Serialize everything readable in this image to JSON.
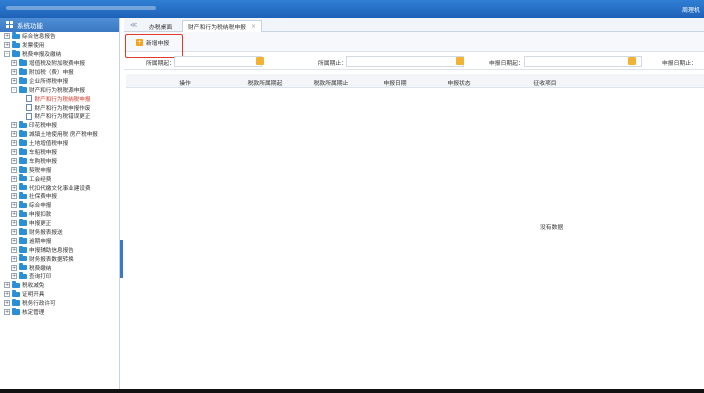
{
  "header": {
    "user_text": "周理机"
  },
  "sidebar": {
    "title": "系统功能",
    "items": [
      {
        "label": "综合信息报告",
        "level": 0,
        "toggle": "+",
        "icon": "folder"
      },
      {
        "label": "发票使用",
        "level": 0,
        "toggle": "+",
        "icon": "folder"
      },
      {
        "label": "税费申报及缴纳",
        "level": 0,
        "toggle": "-",
        "icon": "folder"
      },
      {
        "label": "增值税及附加税费申报",
        "level": 1,
        "toggle": "+",
        "icon": "folder"
      },
      {
        "label": "附加税（费）申报",
        "level": 1,
        "toggle": "+",
        "icon": "folder"
      },
      {
        "label": "企业所得税申报",
        "level": 1,
        "toggle": "+",
        "icon": "folder"
      },
      {
        "label": "财产和行为税税源申报",
        "level": 1,
        "toggle": "-",
        "icon": "folder"
      },
      {
        "label": "财产和行为税纳税申报",
        "level": 2,
        "toggle": "",
        "icon": "doc",
        "active": true
      },
      {
        "label": "财产和行为税申报作废",
        "level": 2,
        "toggle": "",
        "icon": "doc"
      },
      {
        "label": "财产和行为税错误更正",
        "level": 2,
        "toggle": "",
        "icon": "doc"
      },
      {
        "label": "印花税申报",
        "level": 1,
        "toggle": "+",
        "icon": "folder"
      },
      {
        "label": "城镇土地使用税 房产税申报",
        "level": 1,
        "toggle": "+",
        "icon": "folder"
      },
      {
        "label": "土地增值税申报",
        "level": 1,
        "toggle": "+",
        "icon": "folder"
      },
      {
        "label": "车船税申报",
        "level": 1,
        "toggle": "+",
        "icon": "folder"
      },
      {
        "label": "车购税申报",
        "level": 1,
        "toggle": "+",
        "icon": "folder"
      },
      {
        "label": "契税申报",
        "level": 1,
        "toggle": "+",
        "icon": "folder"
      },
      {
        "label": "工会经费",
        "level": 1,
        "toggle": "+",
        "icon": "folder"
      },
      {
        "label": "代扣代缴文化事业建设费",
        "level": 1,
        "toggle": "+",
        "icon": "folder"
      },
      {
        "label": "社保费申报",
        "level": 1,
        "toggle": "+",
        "icon": "folder"
      },
      {
        "label": "综合申报",
        "level": 1,
        "toggle": "+",
        "icon": "folder"
      },
      {
        "label": "申报扣款",
        "level": 1,
        "toggle": "+",
        "icon": "folder"
      },
      {
        "label": "申报更正",
        "level": 1,
        "toggle": "+",
        "icon": "folder"
      },
      {
        "label": "财务报表报送",
        "level": 1,
        "toggle": "+",
        "icon": "folder"
      },
      {
        "label": "逾期申报",
        "level": 1,
        "toggle": "+",
        "icon": "folder"
      },
      {
        "label": "申报辅助信息报告",
        "level": 1,
        "toggle": "+",
        "icon": "folder"
      },
      {
        "label": "财务报表数据转换",
        "level": 1,
        "toggle": "+",
        "icon": "folder"
      },
      {
        "label": "税费缴纳",
        "level": 1,
        "toggle": "+",
        "icon": "folder"
      },
      {
        "label": "查询打印",
        "level": 1,
        "toggle": "+",
        "icon": "folder"
      },
      {
        "label": "税收减免",
        "level": 0,
        "toggle": "+",
        "icon": "folder"
      },
      {
        "label": "证明开具",
        "level": 0,
        "toggle": "+",
        "icon": "folder"
      },
      {
        "label": "税务行政许可",
        "level": 0,
        "toggle": "+",
        "icon": "folder"
      },
      {
        "label": "核定管理",
        "level": 0,
        "toggle": "+",
        "icon": "folder"
      }
    ]
  },
  "tabs": {
    "arrow": "≪",
    "home": "办税桌面",
    "current": "财产和行为税纳税申报",
    "close": "×"
  },
  "toolbar": {
    "new_label": "新增申报"
  },
  "filters": {
    "period_start": "所属期起：",
    "period_end": "所属期止：",
    "date_start": "申报日期起：",
    "date_end": "申报日期止："
  },
  "grid": {
    "columns": [
      "操作",
      "税款所属期起",
      "税款所属期止",
      "申报日期",
      "申报状态",
      "征收项目"
    ],
    "empty_text": "没有数据"
  }
}
